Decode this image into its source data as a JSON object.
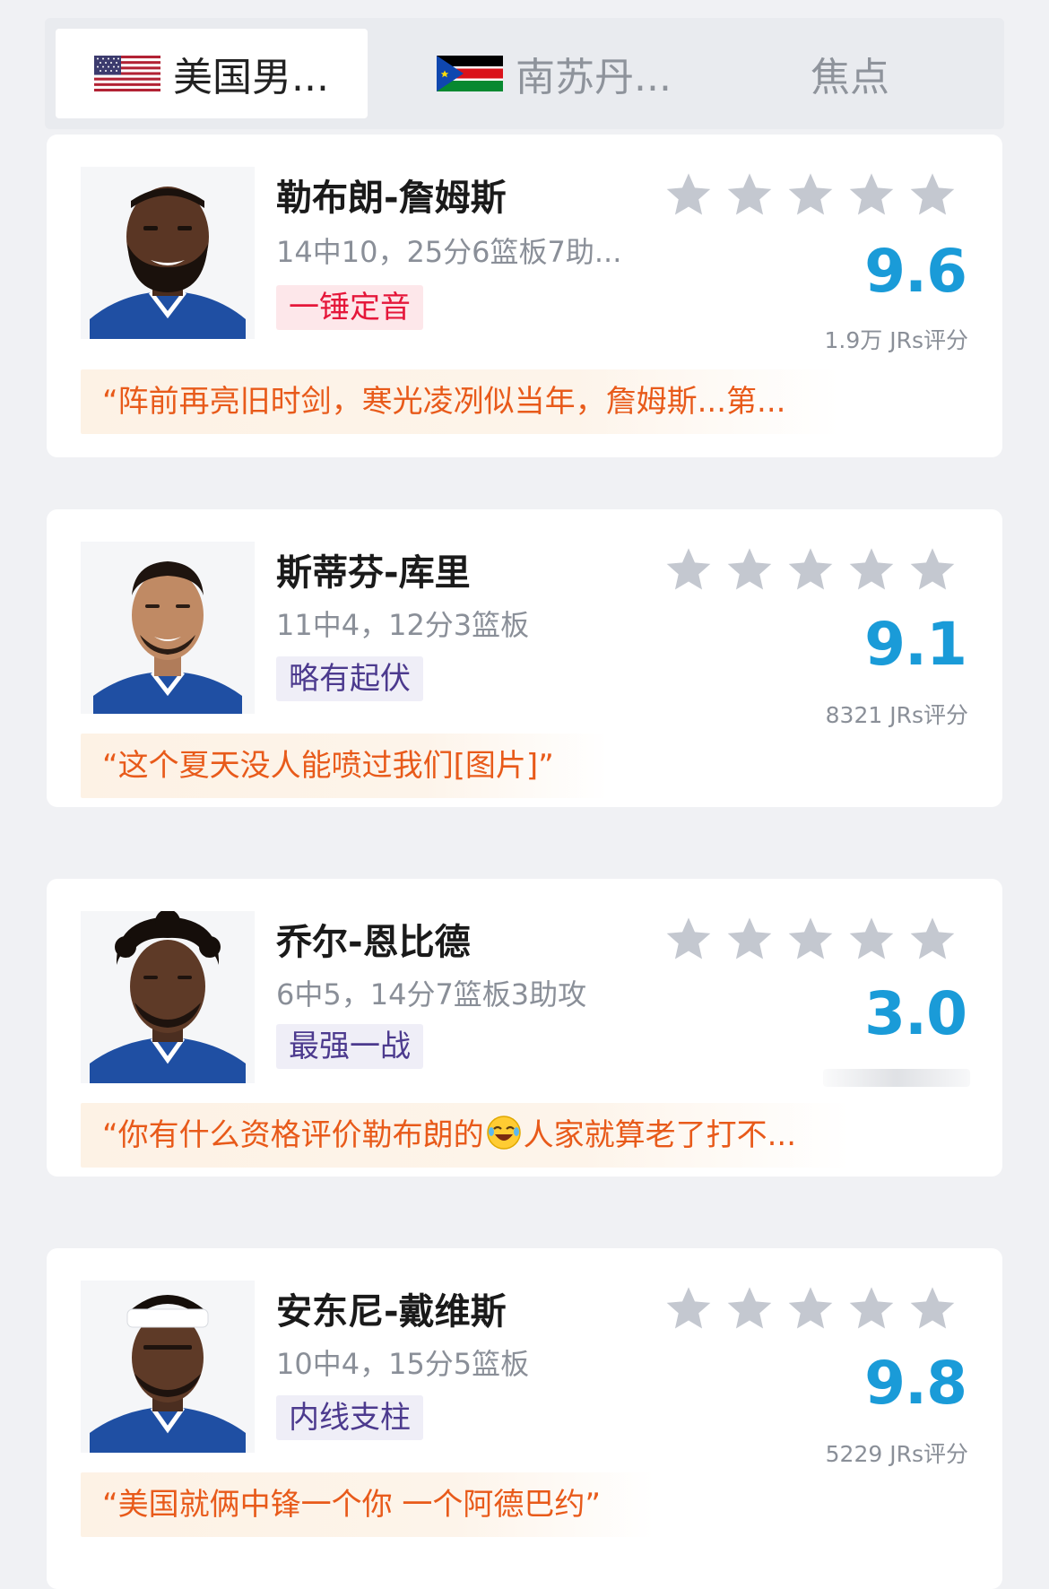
{
  "tabs": [
    {
      "label": "美国男...",
      "flag": "us-flag",
      "active": true
    },
    {
      "label": "南苏丹...",
      "flag": "south-sudan-flag",
      "active": false
    },
    {
      "label": "焦点",
      "active": false
    }
  ],
  "players": [
    {
      "name": "勒布朗-詹姆斯",
      "stat": "14中10，25分6篮板7助...",
      "tag": "一锤定音",
      "tag_color": "#e5173a",
      "stars": 5,
      "score": "9.6",
      "count": "1.9万 JRs评分",
      "comment": "“阵前再亮旧时剑，寒光凌冽似当年，詹姆斯...第..."
    },
    {
      "name": "斯蒂芬-库里",
      "stat": "11中4，12分3篮板",
      "tag": "略有起伏",
      "tag_color": "#4c3a8e",
      "stars": 5,
      "score": "9.1",
      "count": "8321 JRs评分",
      "comment": "“这个夏天没人能喷过我们[图片]”"
    },
    {
      "name": "乔尔-恩比德",
      "stat": "6中5，14分7篮板3助攻",
      "tag": "最强一战",
      "tag_color": "#4c3a8e",
      "stars": 5,
      "score": "3.0",
      "count": "",
      "comment_before": "“你有什么资格评价勒布朗的",
      "comment_emoji": "laughing-crying-emoji",
      "comment_after": "人家就算老了打不..."
    },
    {
      "name": "安东尼-戴维斯",
      "stat": "10中4，15分5篮板",
      "tag": "内线支柱",
      "tag_color": "#4c3a8e",
      "stars": 5,
      "score": "9.8",
      "count": "5229 JRs评分",
      "comment": "“美国就俩中锋一个你 一个阿德巴约”"
    }
  ],
  "colors": {
    "score": "#1a9bd8",
    "star": "#c4c8d0",
    "comment_text": "#e85a1a",
    "comment_bg": "#fdf2e5"
  }
}
